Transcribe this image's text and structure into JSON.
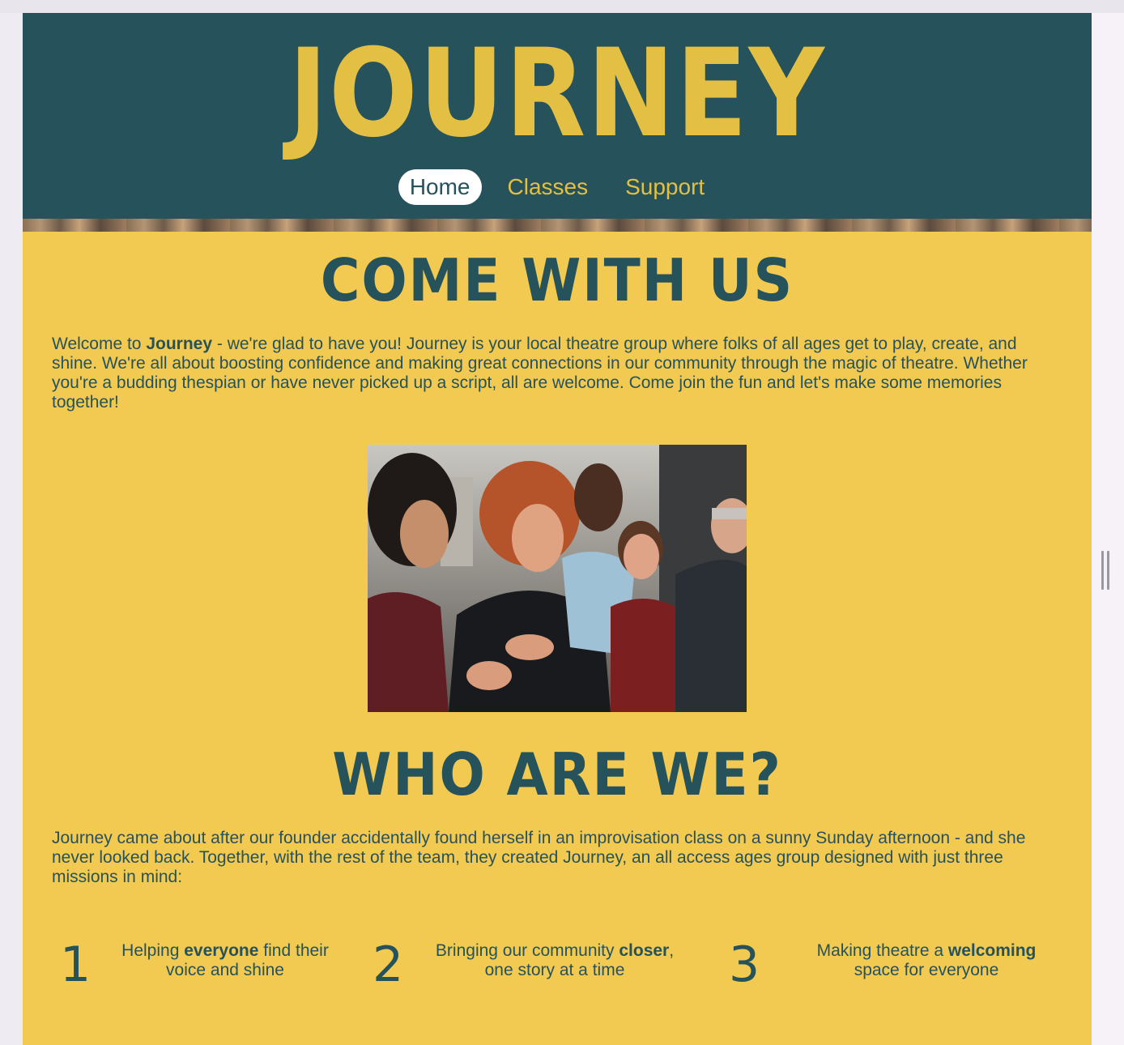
{
  "site": {
    "logo_text": "JOURNEY"
  },
  "nav": {
    "items": [
      {
        "label": "Home",
        "active": true
      },
      {
        "label": "Classes",
        "active": false
      },
      {
        "label": "Support",
        "active": false
      }
    ]
  },
  "sections": {
    "welcome": {
      "title": "COME WITH US",
      "intro_prefix": "Welcome to ",
      "intro_bold": "Journey",
      "intro_rest": " - we're glad to have you! Journey is your local theatre group where folks of all ages get to play, create, and shine. We're all about boosting confidence and making great connections in our community through the magic of theatre. Whether you're a budding thespian or have never picked up a script, all are welcome. Come join the fun and let's make some memories together!"
    },
    "about": {
      "title": "WHO ARE WE?",
      "text": "Journey came about after our founder accidentally found herself in an improvisation class on a sunny Sunday afternoon - and she never looked back. Together, with the rest of the team, they created Journey, an all access ages group designed with just three missions in mind:"
    }
  },
  "missions": [
    {
      "number": "1",
      "before": "Helping ",
      "bold": "everyone",
      "after": " find their voice and shine"
    },
    {
      "number": "2",
      "before": "Bringing our community ",
      "bold": "closer",
      "after": ", one story at a time"
    },
    {
      "number": "3",
      "before": "Making theatre a ",
      "bold": "welcoming",
      "after": " space for everyone"
    }
  ],
  "colors": {
    "header_bg": "#26525b",
    "accent_yellow": "#e3c043",
    "page_bg": "#f2ca52",
    "text": "#26525b"
  }
}
